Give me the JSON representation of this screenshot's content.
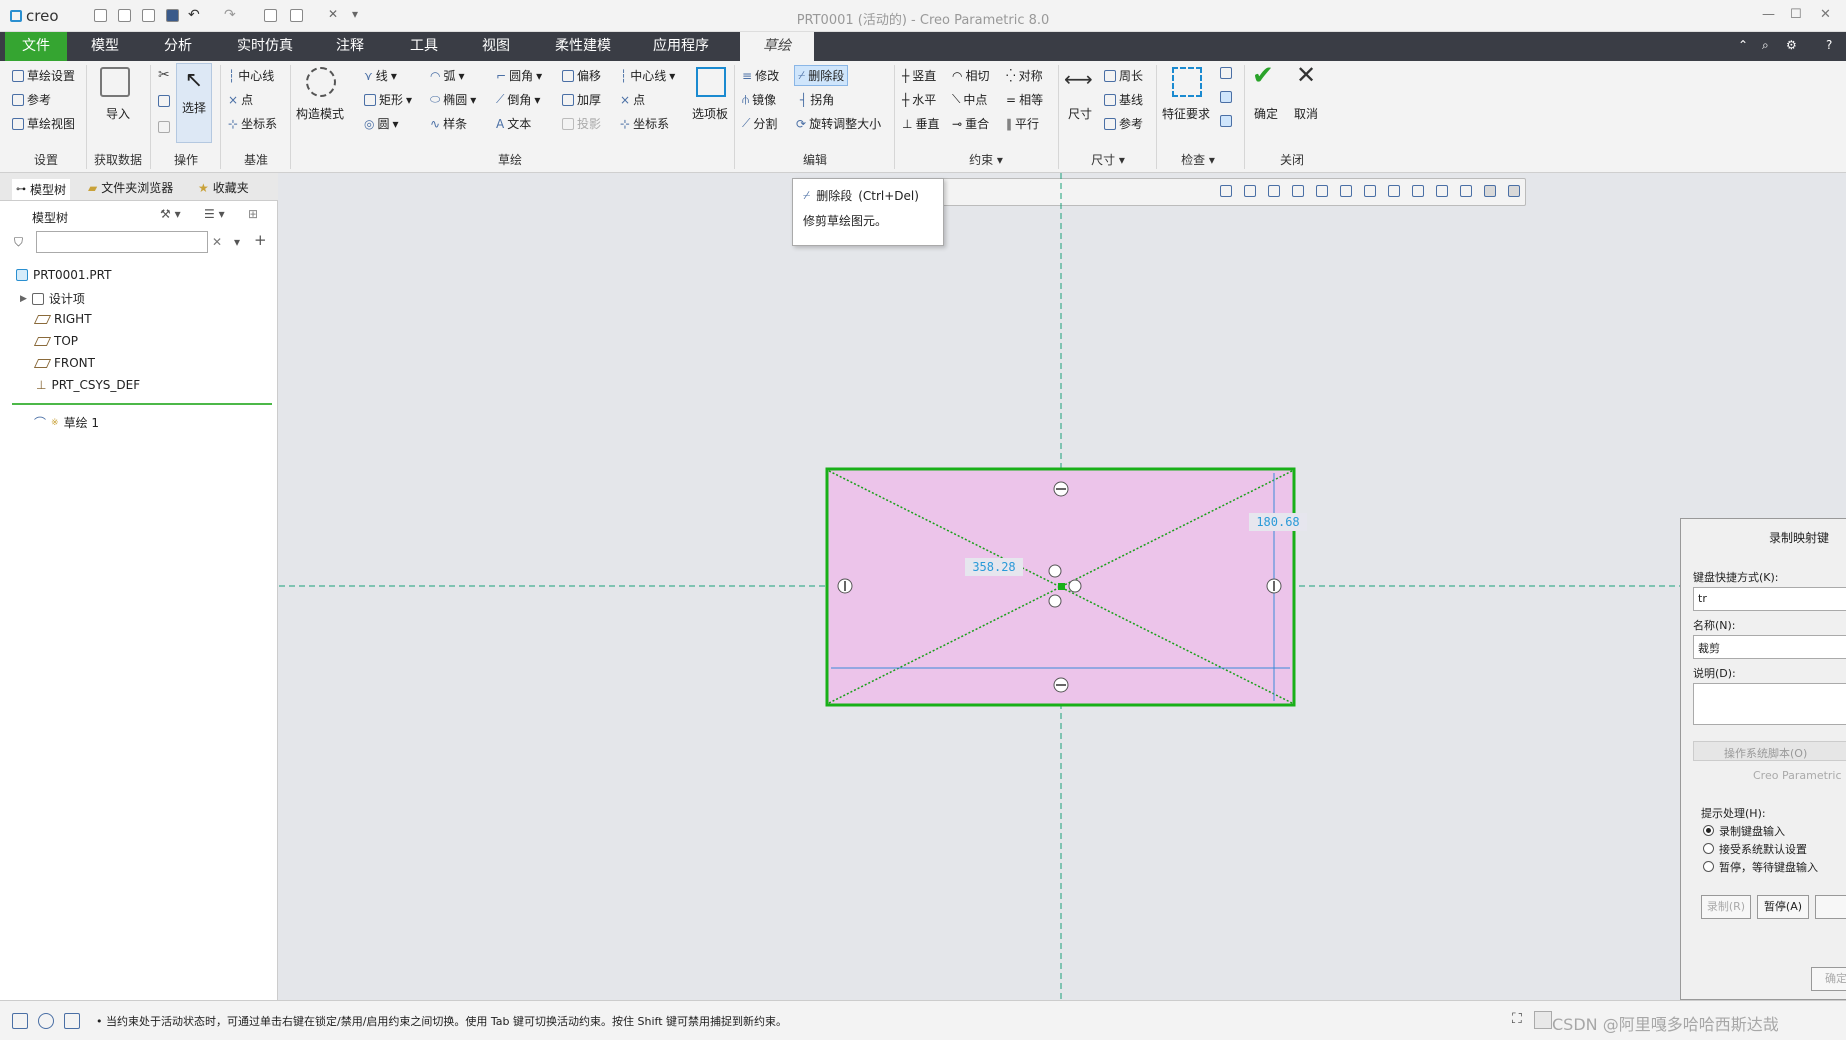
{
  "title_bar": {
    "logo": "creo",
    "window_title": "PRT0001 (活动的) - Creo Parametric 8.0"
  },
  "menu": {
    "tabs": [
      "文件",
      "模型",
      "分析",
      "实时仿真",
      "注释",
      "工具",
      "视图",
      "柔性建模",
      "应用程序",
      "草绘"
    ]
  },
  "ribbon": {
    "setup": {
      "items": [
        "草绘设置",
        "参考",
        "草绘视图"
      ],
      "group": "设置"
    },
    "get_data": {
      "import": "导入",
      "group": "获取数据"
    },
    "operations": {
      "select": "选择",
      "group": "操作"
    },
    "datum": {
      "items": [
        "中心线",
        "点",
        "坐标系"
      ],
      "group": "基准"
    },
    "sketch": {
      "construction": "构造模式",
      "col1": [
        "线",
        "矩形",
        "圆"
      ],
      "col2": [
        "弧",
        "椭圆",
        "样条"
      ],
      "col3": [
        "圆角",
        "倒角",
        "文本"
      ],
      "col4": [
        "偏移",
        "加厚",
        "投影"
      ],
      "col5": [
        "中心线",
        "点",
        "坐标系"
      ],
      "palette": "选项板",
      "group": "草绘"
    },
    "edit": {
      "items": [
        "修改",
        "删除段",
        "镜像",
        "拐角",
        "分割",
        "旋转调整大小"
      ],
      "group": "编辑"
    },
    "constraints": {
      "items": [
        "竖直",
        "相切",
        "对称",
        "水平",
        "中点",
        "相等",
        "垂直",
        "重合",
        "平行"
      ],
      "group": "约束"
    },
    "dimension": {
      "dim": "尺寸",
      "items": [
        "周长",
        "基线",
        "参考"
      ],
      "group": "尺寸"
    },
    "inspect": {
      "feature": "特征要求",
      "group": "检查"
    },
    "close": {
      "ok": "确定",
      "cancel": "取消",
      "group": "关闭"
    }
  },
  "left_panel": {
    "tabs": [
      "模型树",
      "文件夹浏览器",
      "收藏夹"
    ],
    "tree_label": "模型树",
    "tree": [
      "PRT0001.PRT",
      "设计项",
      "RIGHT",
      "TOP",
      "FRONT",
      "PRT_CSYS_DEF"
    ],
    "sketch_item": "草绘 1"
  },
  "tooltip": {
    "title": "删除段",
    "shortcut": "(Ctrl+Del)",
    "desc": "修剪草绘图元。"
  },
  "sketch": {
    "width_dim": "358.28",
    "height_dim": "180.68",
    "fill_color": "#ecc4ea",
    "edge_color": "#18b018"
  },
  "dialog": {
    "title": "录制映射键",
    "shortcut_label": "键盘快捷方式(K):",
    "shortcut_value": "tr",
    "name_label": "名称(N):",
    "name_value": "裁剪",
    "desc_label": "说明(D):",
    "script_tab": "操作系统脚本(O)",
    "script_sub": "Creo Parametric",
    "prompt_label": "提示处理(H):",
    "options": [
      "录制键盘输入",
      "接受系统默认设置",
      "暂停，等待键盘输入"
    ],
    "record_btn": "录制(R)",
    "pause_btn": "暂停(A)",
    "ok_btn": "确定"
  },
  "status": {
    "message": "• 当约束处于活动状态时，可通过单击右键在锁定/禁用/启用约束之间切换。使用 Tab 键可切换活动约束。按住 Shift 键可禁用捕捉到新约束。",
    "watermark": "CSDN @阿里嘎多哈哈西斯达哉"
  }
}
